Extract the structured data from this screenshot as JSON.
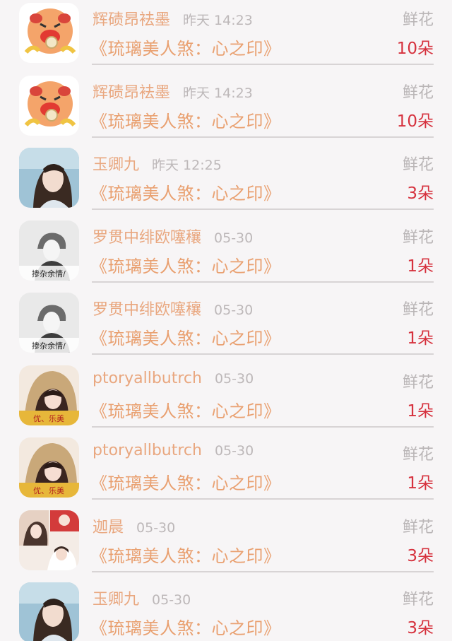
{
  "rows": [
    {
      "avatar": "cartoon-face-avatar",
      "name": "辉碛昂袪墨",
      "time": "昨天 14:23",
      "gift_type": "鲜花",
      "book": "《琉璃美人煞：心之印》",
      "count": "10朵",
      "avatar_caption": ""
    },
    {
      "avatar": "cartoon-face-avatar",
      "name": "辉碛昂袪墨",
      "time": "昨天 14:23",
      "gift_type": "鲜花",
      "book": "《琉璃美人煞：心之印》",
      "count": "10朵",
      "avatar_caption": ""
    },
    {
      "avatar": "woman-photo-avatar",
      "name": "玉卿九",
      "time": "昨天 12:25",
      "gift_type": "鲜花",
      "book": "《琉璃美人煞：心之印》",
      "count": "3朵",
      "avatar_caption": ""
    },
    {
      "avatar": "grayscale-boy-avatar",
      "name": "罗贯中绯欧噻穰",
      "time": "05-30",
      "gift_type": "鲜花",
      "book": "《琉璃美人煞：心之印》",
      "count": "1朵",
      "avatar_caption": "掺杂余情/"
    },
    {
      "avatar": "grayscale-boy-avatar",
      "name": "罗贯中绯欧噻穰",
      "time": "05-30",
      "gift_type": "鲜花",
      "book": "《琉璃美人煞：心之印》",
      "count": "1朵",
      "avatar_caption": "掺杂余情/"
    },
    {
      "avatar": "hooded-girl-avatar",
      "name": "ptoryallbutrch",
      "time": "05-30",
      "gift_type": "鲜花",
      "book": "《琉璃美人煞：心之印》",
      "count": "1朵",
      "avatar_caption": "优、乐美"
    },
    {
      "avatar": "hooded-girl-avatar",
      "name": "ptoryallbutrch",
      "time": "05-30",
      "gift_type": "鲜花",
      "book": "《琉璃美人煞：心之印》",
      "count": "1朵",
      "avatar_caption": "优、乐美"
    },
    {
      "avatar": "collage-photo-avatar",
      "name": "迦晨",
      "time": "05-30",
      "gift_type": "鲜花",
      "book": "《琉璃美人煞：心之印》",
      "count": "3朵",
      "avatar_caption": ""
    },
    {
      "avatar": "woman-photo-avatar",
      "name": "玉卿九",
      "time": "05-30",
      "gift_type": "鲜花",
      "book": "《琉璃美人煞：心之印》",
      "count": "3朵",
      "avatar_caption": ""
    }
  ]
}
